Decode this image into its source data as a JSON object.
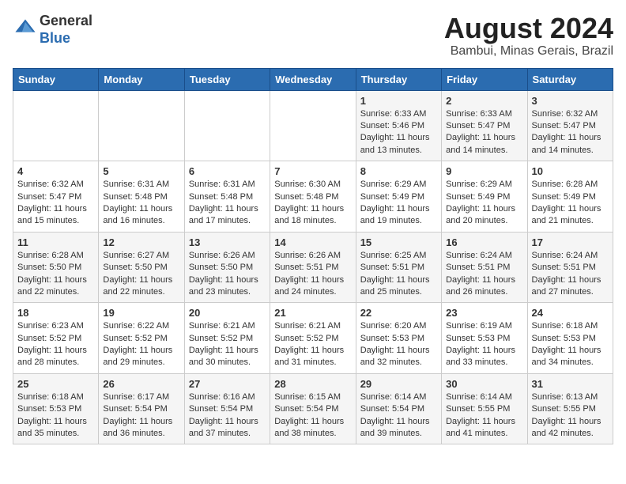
{
  "title": "August 2024",
  "subtitle": "Bambui, Minas Gerais, Brazil",
  "logo": {
    "line1": "General",
    "line2": "Blue"
  },
  "days_of_week": [
    "Sunday",
    "Monday",
    "Tuesday",
    "Wednesday",
    "Thursday",
    "Friday",
    "Saturday"
  ],
  "weeks": [
    [
      {
        "day": "",
        "info": ""
      },
      {
        "day": "",
        "info": ""
      },
      {
        "day": "",
        "info": ""
      },
      {
        "day": "",
        "info": ""
      },
      {
        "day": "1",
        "info": "Sunrise: 6:33 AM\nSunset: 5:46 PM\nDaylight: 11 hours and 13 minutes."
      },
      {
        "day": "2",
        "info": "Sunrise: 6:33 AM\nSunset: 5:47 PM\nDaylight: 11 hours and 14 minutes."
      },
      {
        "day": "3",
        "info": "Sunrise: 6:32 AM\nSunset: 5:47 PM\nDaylight: 11 hours and 14 minutes."
      }
    ],
    [
      {
        "day": "4",
        "info": "Sunrise: 6:32 AM\nSunset: 5:47 PM\nDaylight: 11 hours and 15 minutes."
      },
      {
        "day": "5",
        "info": "Sunrise: 6:31 AM\nSunset: 5:48 PM\nDaylight: 11 hours and 16 minutes."
      },
      {
        "day": "6",
        "info": "Sunrise: 6:31 AM\nSunset: 5:48 PM\nDaylight: 11 hours and 17 minutes."
      },
      {
        "day": "7",
        "info": "Sunrise: 6:30 AM\nSunset: 5:48 PM\nDaylight: 11 hours and 18 minutes."
      },
      {
        "day": "8",
        "info": "Sunrise: 6:29 AM\nSunset: 5:49 PM\nDaylight: 11 hours and 19 minutes."
      },
      {
        "day": "9",
        "info": "Sunrise: 6:29 AM\nSunset: 5:49 PM\nDaylight: 11 hours and 20 minutes."
      },
      {
        "day": "10",
        "info": "Sunrise: 6:28 AM\nSunset: 5:49 PM\nDaylight: 11 hours and 21 minutes."
      }
    ],
    [
      {
        "day": "11",
        "info": "Sunrise: 6:28 AM\nSunset: 5:50 PM\nDaylight: 11 hours and 22 minutes."
      },
      {
        "day": "12",
        "info": "Sunrise: 6:27 AM\nSunset: 5:50 PM\nDaylight: 11 hours and 22 minutes."
      },
      {
        "day": "13",
        "info": "Sunrise: 6:26 AM\nSunset: 5:50 PM\nDaylight: 11 hours and 23 minutes."
      },
      {
        "day": "14",
        "info": "Sunrise: 6:26 AM\nSunset: 5:51 PM\nDaylight: 11 hours and 24 minutes."
      },
      {
        "day": "15",
        "info": "Sunrise: 6:25 AM\nSunset: 5:51 PM\nDaylight: 11 hours and 25 minutes."
      },
      {
        "day": "16",
        "info": "Sunrise: 6:24 AM\nSunset: 5:51 PM\nDaylight: 11 hours and 26 minutes."
      },
      {
        "day": "17",
        "info": "Sunrise: 6:24 AM\nSunset: 5:51 PM\nDaylight: 11 hours and 27 minutes."
      }
    ],
    [
      {
        "day": "18",
        "info": "Sunrise: 6:23 AM\nSunset: 5:52 PM\nDaylight: 11 hours and 28 minutes."
      },
      {
        "day": "19",
        "info": "Sunrise: 6:22 AM\nSunset: 5:52 PM\nDaylight: 11 hours and 29 minutes."
      },
      {
        "day": "20",
        "info": "Sunrise: 6:21 AM\nSunset: 5:52 PM\nDaylight: 11 hours and 30 minutes."
      },
      {
        "day": "21",
        "info": "Sunrise: 6:21 AM\nSunset: 5:52 PM\nDaylight: 11 hours and 31 minutes."
      },
      {
        "day": "22",
        "info": "Sunrise: 6:20 AM\nSunset: 5:53 PM\nDaylight: 11 hours and 32 minutes."
      },
      {
        "day": "23",
        "info": "Sunrise: 6:19 AM\nSunset: 5:53 PM\nDaylight: 11 hours and 33 minutes."
      },
      {
        "day": "24",
        "info": "Sunrise: 6:18 AM\nSunset: 5:53 PM\nDaylight: 11 hours and 34 minutes."
      }
    ],
    [
      {
        "day": "25",
        "info": "Sunrise: 6:18 AM\nSunset: 5:53 PM\nDaylight: 11 hours and 35 minutes."
      },
      {
        "day": "26",
        "info": "Sunrise: 6:17 AM\nSunset: 5:54 PM\nDaylight: 11 hours and 36 minutes."
      },
      {
        "day": "27",
        "info": "Sunrise: 6:16 AM\nSunset: 5:54 PM\nDaylight: 11 hours and 37 minutes."
      },
      {
        "day": "28",
        "info": "Sunrise: 6:15 AM\nSunset: 5:54 PM\nDaylight: 11 hours and 38 minutes."
      },
      {
        "day": "29",
        "info": "Sunrise: 6:14 AM\nSunset: 5:54 PM\nDaylight: 11 hours and 39 minutes."
      },
      {
        "day": "30",
        "info": "Sunrise: 6:14 AM\nSunset: 5:55 PM\nDaylight: 11 hours and 41 minutes."
      },
      {
        "day": "31",
        "info": "Sunrise: 6:13 AM\nSunset: 5:55 PM\nDaylight: 11 hours and 42 minutes."
      }
    ]
  ]
}
